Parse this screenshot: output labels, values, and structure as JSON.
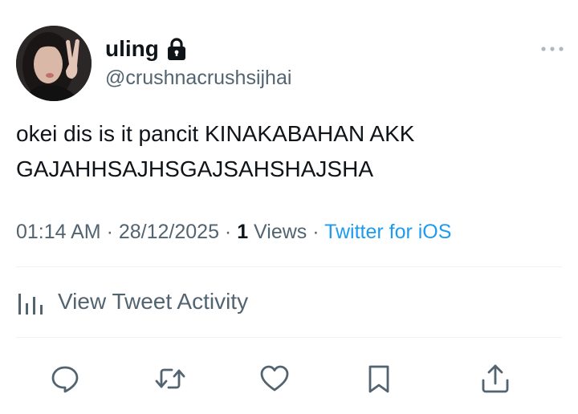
{
  "user": {
    "display_name": "uling",
    "handle": "@crushnacrushsijhai",
    "protected_icon": "lock-icon",
    "avatar": "profile-photo"
  },
  "tweet": {
    "text": "okei dis is it pancit KINAKABAHAN AKK\nGAJAHHSAJHSGAJSAHSHAJSHA",
    "time": "01:14 AM",
    "separator1": " · ",
    "date": "28/12/2025",
    "separator2": " · ",
    "views_count": "1",
    "views_label": " Views",
    "separator3": " · ",
    "source": "Twitter for iOS"
  },
  "activity": {
    "label": "View Tweet Activity",
    "icon": "analytics-icon"
  },
  "actions": {
    "reply_icon": "reply-icon",
    "retweet_icon": "retweet-icon",
    "like_icon": "heart-icon",
    "bookmark_icon": "bookmark-icon",
    "share_icon": "share-icon"
  },
  "colors": {
    "text_primary": "#0f1419",
    "text_secondary": "#536471",
    "link": "#1d9bf0",
    "divider": "#eff3f4"
  }
}
